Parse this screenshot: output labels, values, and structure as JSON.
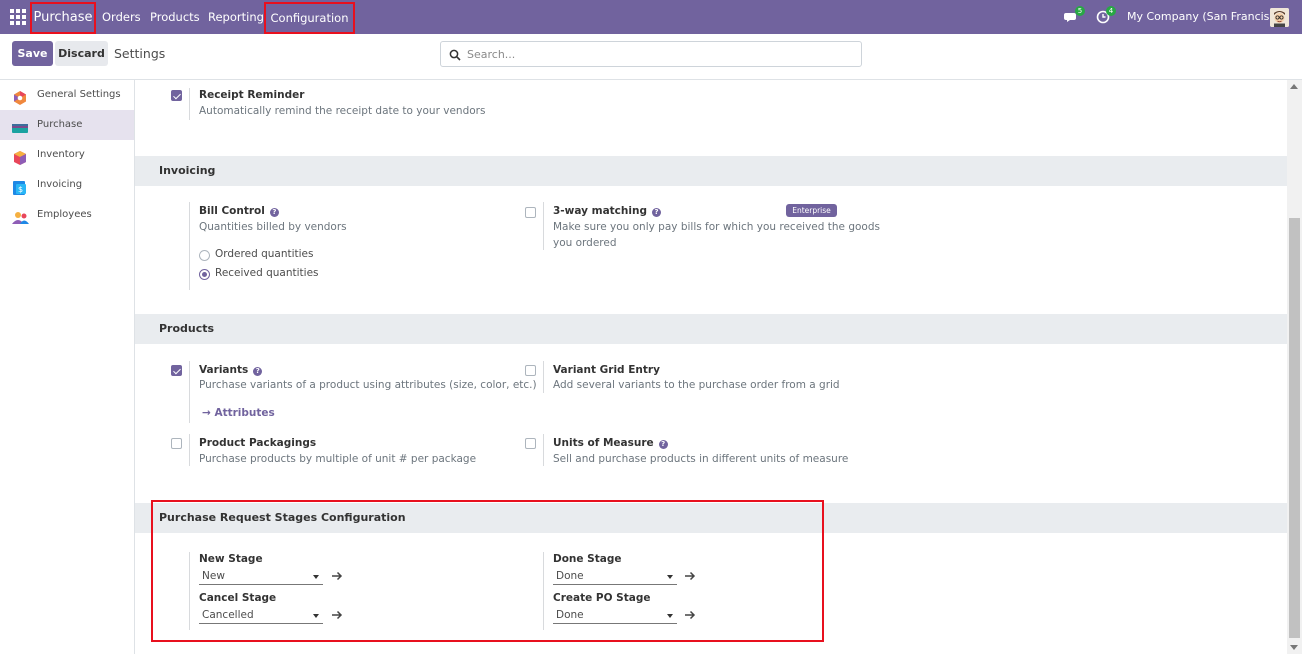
{
  "navbar": {
    "brand": "Purchase",
    "menu": [
      "Orders",
      "Products",
      "Reporting",
      "Configuration"
    ],
    "messages_count": "5",
    "activities_count": "4",
    "company": "My Company (San Francisco)"
  },
  "control_panel": {
    "save_label": "Save",
    "discard_label": "Discard",
    "title": "Settings",
    "search_placeholder": "Search..."
  },
  "sidebar": {
    "items": [
      {
        "label": "General Settings",
        "icon": "general-settings-icon"
      },
      {
        "label": "Purchase",
        "icon": "purchase-app-icon"
      },
      {
        "label": "Inventory",
        "icon": "inventory-app-icon"
      },
      {
        "label": "Invoicing",
        "icon": "invoicing-app-icon"
      },
      {
        "label": "Employees",
        "icon": "employees-app-icon"
      }
    ],
    "active": "Purchase"
  },
  "settings": {
    "receipt_reminder": {
      "title": "Receipt Reminder",
      "desc": "Automatically remind the receipt date to your vendors",
      "checked": true
    },
    "invoicing": {
      "header": "Invoicing",
      "bill_control": {
        "title": "Bill Control",
        "desc": "Quantities billed by vendors",
        "options": [
          "Ordered quantities",
          "Received quantities"
        ],
        "selected": "Received quantities"
      },
      "three_way": {
        "title": "3-way matching",
        "badge": "Enterprise",
        "desc_line1": "Make sure you only pay bills for which you received the goods",
        "desc_line2": "you ordered",
        "checked": false
      }
    },
    "products": {
      "header": "Products",
      "variants": {
        "title": "Variants",
        "desc": "Purchase variants of a product using attributes (size, color, etc.)",
        "link": "Attributes",
        "checked": true
      },
      "variant_grid": {
        "title": "Variant Grid Entry",
        "desc": "Add several variants to the purchase order from a grid",
        "checked": false
      },
      "packagings": {
        "title": "Product Packagings",
        "desc": "Purchase products by multiple of unit # per package",
        "checked": false
      },
      "uom": {
        "title": "Units of Measure",
        "desc": "Sell and purchase products in different units of measure",
        "checked": false
      }
    },
    "stages": {
      "header": "Purchase Request Stages Configuration",
      "new_stage": {
        "label": "New Stage",
        "value": "New"
      },
      "done_stage": {
        "label": "Done Stage",
        "value": "Done"
      },
      "cancel_stage": {
        "label": "Cancel Stage",
        "value": "Cancelled"
      },
      "create_po_stage": {
        "label": "Create PO Stage",
        "value": "Done"
      }
    }
  },
  "colors": {
    "brand": "#71639e",
    "highlight": "#e8101e",
    "badge_green": "#28a745"
  }
}
